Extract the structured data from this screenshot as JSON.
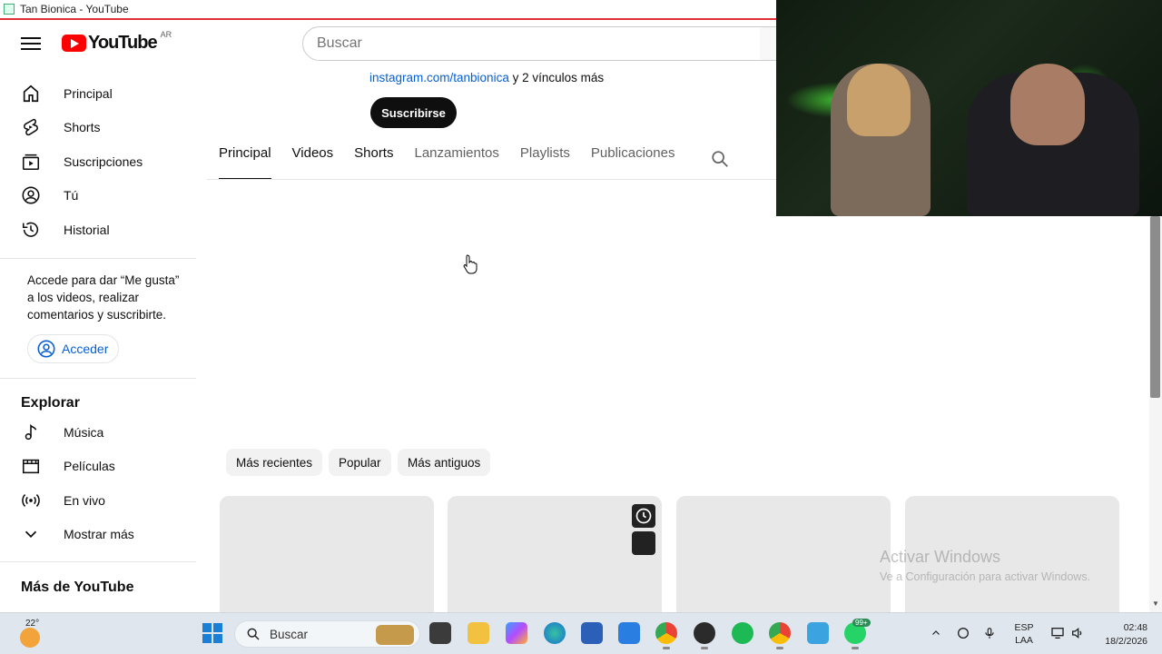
{
  "window": {
    "title": "Tan Bionica - YouTube"
  },
  "masthead": {
    "logo_text": "YouTube",
    "region": "AR",
    "search_placeholder": "Buscar"
  },
  "sidebar": {
    "items": [
      {
        "label": "Principal",
        "icon": "home-icon"
      },
      {
        "label": "Shorts",
        "icon": "shorts-icon"
      },
      {
        "label": "Suscripciones",
        "icon": "subscriptions-icon"
      },
      {
        "label": "Tú",
        "icon": "user-icon"
      },
      {
        "label": "Historial",
        "icon": "history-icon"
      }
    ],
    "signin_text": "Accede para dar “Me gusta” a los videos, realizar comentarios y suscribirte.",
    "signin_button": "Acceder",
    "explore_heading": "Explorar",
    "explore_items": [
      {
        "label": "Música",
        "icon": "music-icon"
      },
      {
        "label": "Películas",
        "icon": "movie-icon"
      },
      {
        "label": "En vivo",
        "icon": "live-icon"
      },
      {
        "label": "Mostrar más",
        "icon": "chevron-down-icon"
      }
    ],
    "more_heading": "Más de YouTube"
  },
  "channel": {
    "link_text": "instagram.com/tanbionica",
    "link_suffix": "y 2 vínculos más",
    "subscribe_label": "Suscribirse",
    "tabs": [
      "Principal",
      "Videos",
      "Shorts",
      "Lanzamientos",
      "Playlists",
      "Publicaciones"
    ],
    "active_tab": "Principal"
  },
  "chips": [
    "Más recientes",
    "Popular",
    "Más antiguos"
  ],
  "watermark": {
    "title": "Activar Windows",
    "subtitle": "Ve a Configuración para activar Windows."
  },
  "taskbar": {
    "weather_temp": "22°",
    "search_placeholder": "Buscar",
    "whatsapp_badge": "99+",
    "lang_line1": "ESP",
    "lang_line2": "LAA",
    "time": "02:48",
    "date": "18/2/2026"
  },
  "colors": {
    "youtube_red": "#ff0000",
    "link_blue": "#065fd4",
    "taskbar_bg": "#dfe6ee"
  }
}
